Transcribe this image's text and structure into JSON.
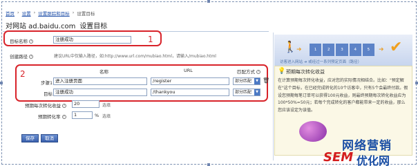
{
  "breadcrumb": [
    "首页",
    "设置",
    "设置跟踪和目标",
    "设置目标"
  ],
  "page": {
    "title_site": "对网站 ad.baidu.com",
    "title_action": "设置目标"
  },
  "annotations": {
    "one": "1",
    "two": "2"
  },
  "form": {
    "goal_name_label": "目标名称",
    "goal_name_value": "注册成功",
    "path_label": "创建路径",
    "path_hint": "建议URL中仅输入路径，如:http://www.url.com/mubiao.html，请输入/mubiao.html",
    "table_headers": {
      "name": "名称",
      "url": "URL",
      "match": "匹配方式"
    },
    "rows": [
      {
        "label": "步骤1",
        "name": "进入注册页面",
        "url": "/register",
        "match": "部分匹配"
      },
      {
        "label": "目标",
        "name": "注册成功",
        "url": "/thankyou",
        "match": "部分匹配"
      }
    ],
    "per_conv_label": "预期每次转化收益",
    "per_conv_value": "20",
    "per_conv_unit": "选填",
    "conv_rate_label": "预期转化率",
    "conv_rate_value": "1",
    "conv_rate_unit": "%",
    "conv_rate_note": "选填"
  },
  "buttons": {
    "save": "保存",
    "cancel": "取消"
  },
  "sidebar": {
    "banner_left": "访客进入网站",
    "banner_right": "或经过一系列预定页面（路径）",
    "banner_steps": [
      "1",
      "2",
      "3",
      "4",
      "5"
    ],
    "tip_title": "预期每次转化收益",
    "tip_text": "在计算预期每次转化收益，应对您的实际情况相结合。比如：\"预定解在\"这个目标，在已经完成转化的10个访客中，只有5个会最终付款。假设您预期每笔订单可以获得100元收益，则最终预期每次转化收益应为100*50%=50元；若每个完成转化的客户都能带来一定的收益，那么您应该设定为该值。"
  },
  "watermark": {
    "line1": "网络营销",
    "sem": "SEM",
    "line2": "优化网"
  }
}
